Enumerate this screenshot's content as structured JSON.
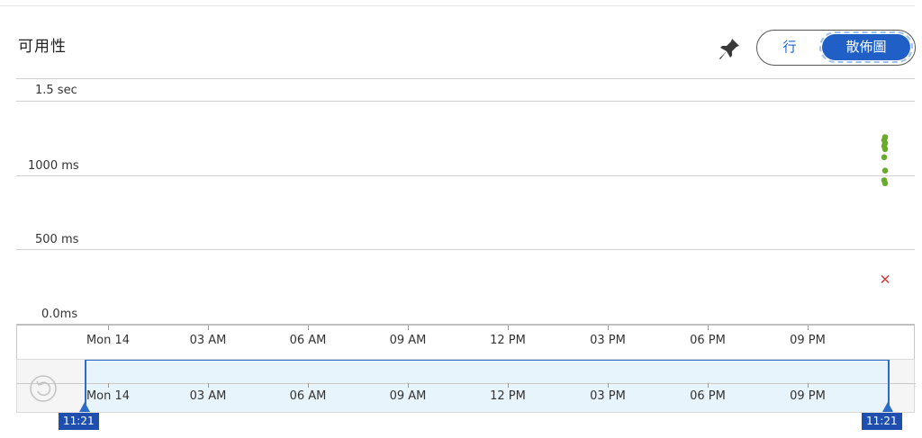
{
  "panel": {
    "title": "可用性",
    "pin_icon": "pin-icon",
    "toggle": {
      "line_label": "行",
      "scatter_label": "散佈圖",
      "selected": "散佈圖"
    }
  },
  "chart_data": {
    "type": "scatter",
    "y_axis": {
      "labels": [
        "1.5 sec",
        "1000 ms",
        "500 ms",
        "0.0ms"
      ],
      "range_ms": [
        0,
        1500
      ]
    },
    "x_axis": {
      "labels": [
        "Mon 14",
        "03 AM",
        "06 AM",
        "09 AM",
        "12 PM",
        "03 PM",
        "06 PM",
        "09 PM"
      ]
    },
    "series": [
      {
        "color": "#6aab2c",
        "marker": "circle",
        "points": [
          {
            "x": "11:21",
            "y_ms": 1255
          },
          {
            "x": "11:21",
            "y_ms": 1235
          },
          {
            "x": "11:21",
            "y_ms": 1215
          },
          {
            "x": "11:21",
            "y_ms": 1195
          },
          {
            "x": "11:21",
            "y_ms": 1175
          },
          {
            "x": "11:21",
            "y_ms": 1120
          },
          {
            "x": "11:21",
            "y_ms": 1030
          },
          {
            "x": "11:21",
            "y_ms": 965
          },
          {
            "x": "11:21",
            "y_ms": 945
          }
        ]
      },
      {
        "color": "#d93636",
        "marker": "x",
        "points": [
          {
            "x": "11:21",
            "y_ms": 300
          }
        ]
      }
    ]
  },
  "navigator": {
    "x_labels": [
      "Mon 14",
      "03 AM",
      "06 AM",
      "09 AM",
      "12 PM",
      "03 PM",
      "06 PM",
      "09 PM"
    ],
    "start_label": "11:21",
    "end_label": "11:21",
    "reset_icon": "reset-zoom-icon"
  }
}
